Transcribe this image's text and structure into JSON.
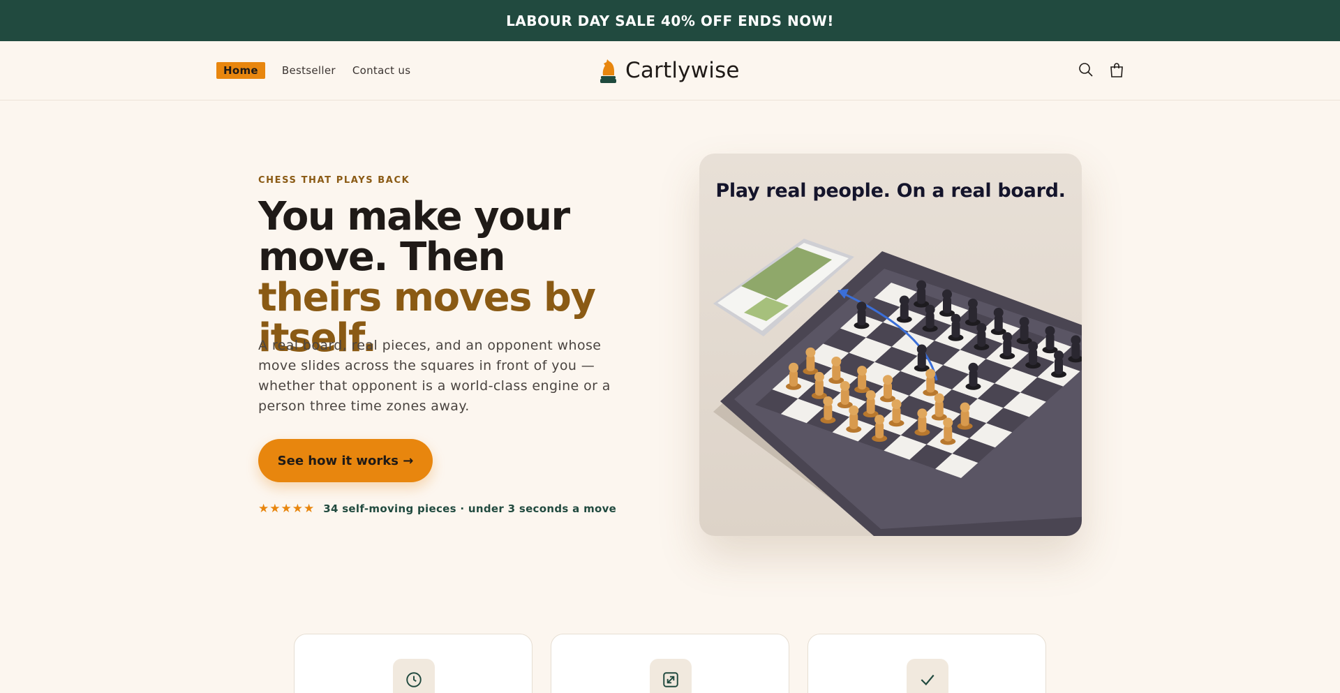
{
  "announcement": {
    "text": "LABOUR DAY SALE 40% OFF ENDS NOW!"
  },
  "header": {
    "nav": [
      {
        "label": "Home",
        "active": true
      },
      {
        "label": "Bestseller",
        "active": false
      },
      {
        "label": "Contact us",
        "active": false
      }
    ],
    "brand": "Cartlywise",
    "icons": [
      "search-icon",
      "cart-icon"
    ]
  },
  "hero": {
    "eyebrow": "CHESS THAT PLAYS BACK",
    "headline_part1": "You make your move. Then ",
    "headline_accent": "theirs moves by itself.",
    "description": "A real board, real pieces, and an opponent whose move slides across the squares in front of you — whether that opponent is a world-class engine or a person three time zones away.",
    "cta_label": "See how it works →",
    "stars": "★★★★★",
    "rating_text": "34 self-moving pieces · under 3 seconds a move",
    "image_title": "Play real people. On a real board."
  },
  "features": [
    {
      "icon": "clock-icon"
    },
    {
      "icon": "expand-icon"
    },
    {
      "icon": "check-icon"
    }
  ],
  "colors": {
    "announcement_bg": "#214a3f",
    "accent": "#e8860e",
    "accent_text": "#8a5a14",
    "page_bg": "#fcf6ef"
  }
}
